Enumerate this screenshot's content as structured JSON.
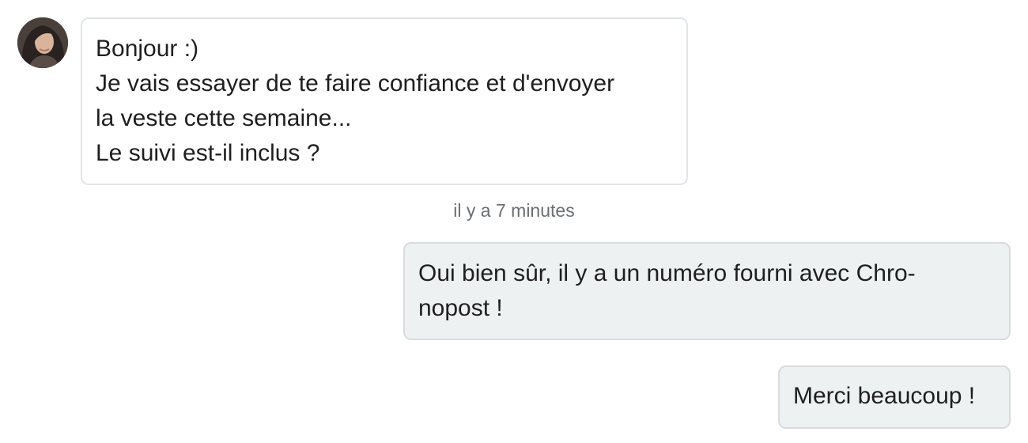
{
  "conversation": {
    "incoming": {
      "avatar_icon": "user-avatar-photo",
      "lines": [
        "Bonjour :)",
        "Je vais essayer de te faire confiance et d'envoyer",
        "la veste cette semaine...",
        "Le suivi est-il inclus ?"
      ]
    },
    "timestamp": "il y a 7 minutes",
    "outgoing": [
      {
        "lines": [
          "Oui bien sûr, il y a un numéro fourni avec Chro-",
          "nopost !"
        ]
      },
      {
        "lines": [
          "Merci beaucoup !"
        ]
      }
    ]
  },
  "colors": {
    "incoming_bubble_bg": "#ffffff",
    "incoming_bubble_border": "#e2e5e8",
    "outgoing_bubble_bg": "#eef1f2",
    "outgoing_bubble_border": "#d9dcdf",
    "timestamp_text": "#6b6f73",
    "message_text": "#1f1f1f"
  }
}
